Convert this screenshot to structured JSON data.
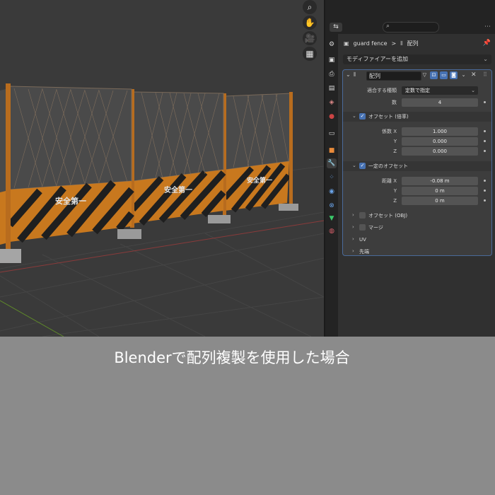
{
  "viewport": {
    "nav_buttons": [
      {
        "name": "zoom-icon",
        "glyph": "⌕"
      },
      {
        "name": "hand-pan-icon",
        "glyph": "✋"
      },
      {
        "name": "camera-view-icon",
        "glyph": "🎥"
      },
      {
        "name": "grid-view-icon",
        "glyph": "▦"
      }
    ],
    "fence_sign_text": "安全第一"
  },
  "properties": {
    "editor_type_glyph": "⇆",
    "search": {
      "value": "",
      "icon": "search-icon"
    },
    "header_options": "⋯",
    "breadcrumb": {
      "object": "guard fence",
      "separator": ">",
      "modifier": "配列"
    },
    "add_modifier_label": "モディファイアーを追加",
    "modifier": {
      "name": "配列",
      "fields": {
        "fit_type_label": "適合する種類",
        "fit_type_value": "定数で指定",
        "count_label": "数",
        "count_value": "4"
      },
      "relative_offset": {
        "label": "オフセット (倍率)",
        "rows": [
          {
            "label": "係数 X",
            "value": "1.000"
          },
          {
            "label": "Y",
            "value": "0.000"
          },
          {
            "label": "Z",
            "value": "0.000"
          }
        ]
      },
      "constant_offset": {
        "label": "一定のオフセット",
        "rows": [
          {
            "label": "距離 X",
            "value": "-0.08 m"
          },
          {
            "label": "Y",
            "value": "0 m"
          },
          {
            "label": "Z",
            "value": "0 m"
          }
        ]
      },
      "object_offset_label": "オフセット (OBJ)",
      "merge_label": "マージ",
      "uv_label": "UV",
      "caps_label": "先端"
    }
  },
  "caption": "Blenderで配列複製を使用した場合",
  "colors": {
    "accent": "#4772b3",
    "panel_bg": "#303030",
    "viewport_bg": "#3a3a3a",
    "fence_orange": "#c87a28"
  }
}
